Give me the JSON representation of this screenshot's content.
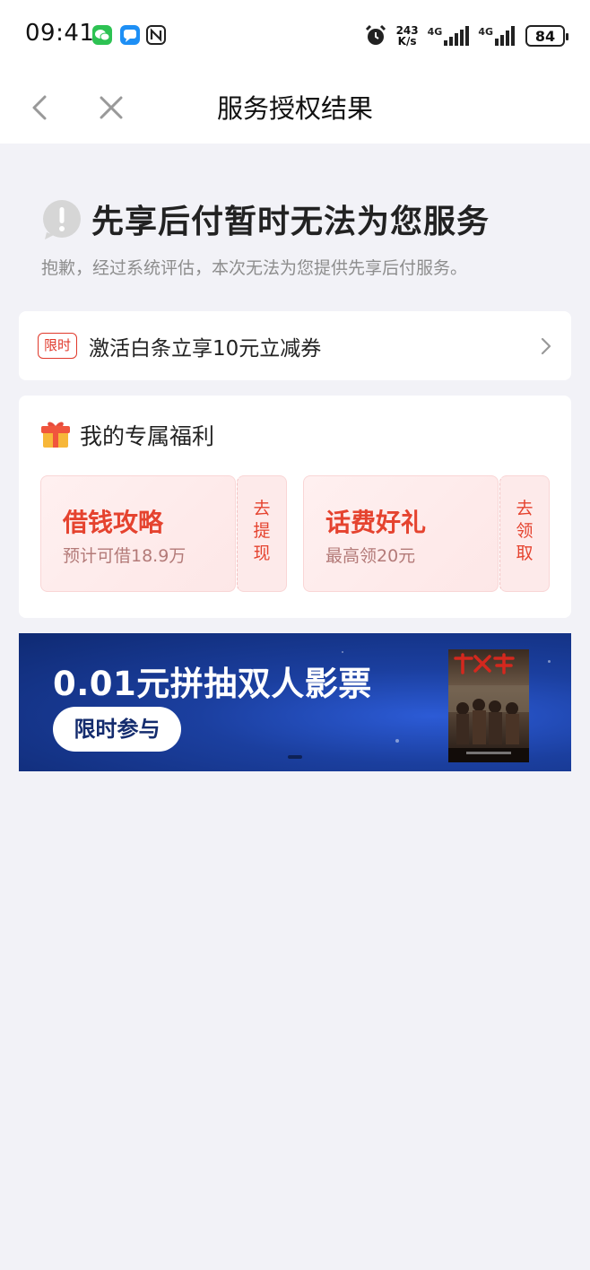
{
  "status_bar": {
    "time": "09:41",
    "net_speed_value": "243",
    "net_speed_unit": "K/s",
    "signal_1": "4G",
    "signal_2": "4G",
    "battery": "84",
    "app_icons": [
      "wechat-icon",
      "chat-bubble-icon",
      "nfc-icon"
    ]
  },
  "nav": {
    "title": "服务授权结果"
  },
  "result": {
    "title": "先享后付暂时无法为您服务",
    "subtitle": "抱歉，经过系统评估，本次无法为您提供先享后付服务。"
  },
  "promo": {
    "badge": "限时",
    "text": "激活白条立享10元立减券"
  },
  "benefits": {
    "title": "我的专属福利",
    "coupons": [
      {
        "title": "借钱攻略",
        "subtitle": "预计可借18.9万",
        "action": "去提现",
        "action_chars": [
          "去",
          "提",
          "现"
        ]
      },
      {
        "title": "话费好礼",
        "subtitle": "最高领20元",
        "action": "去领取",
        "action_chars": [
          "去",
          "领",
          "取"
        ]
      }
    ]
  },
  "banner": {
    "title": "0.01元拼抽双人影票",
    "button": "限时参与"
  },
  "colors": {
    "accent_red": "#e5432f",
    "banner_blue": "#1b3f9f",
    "page_bg": "#f2f2f7"
  }
}
